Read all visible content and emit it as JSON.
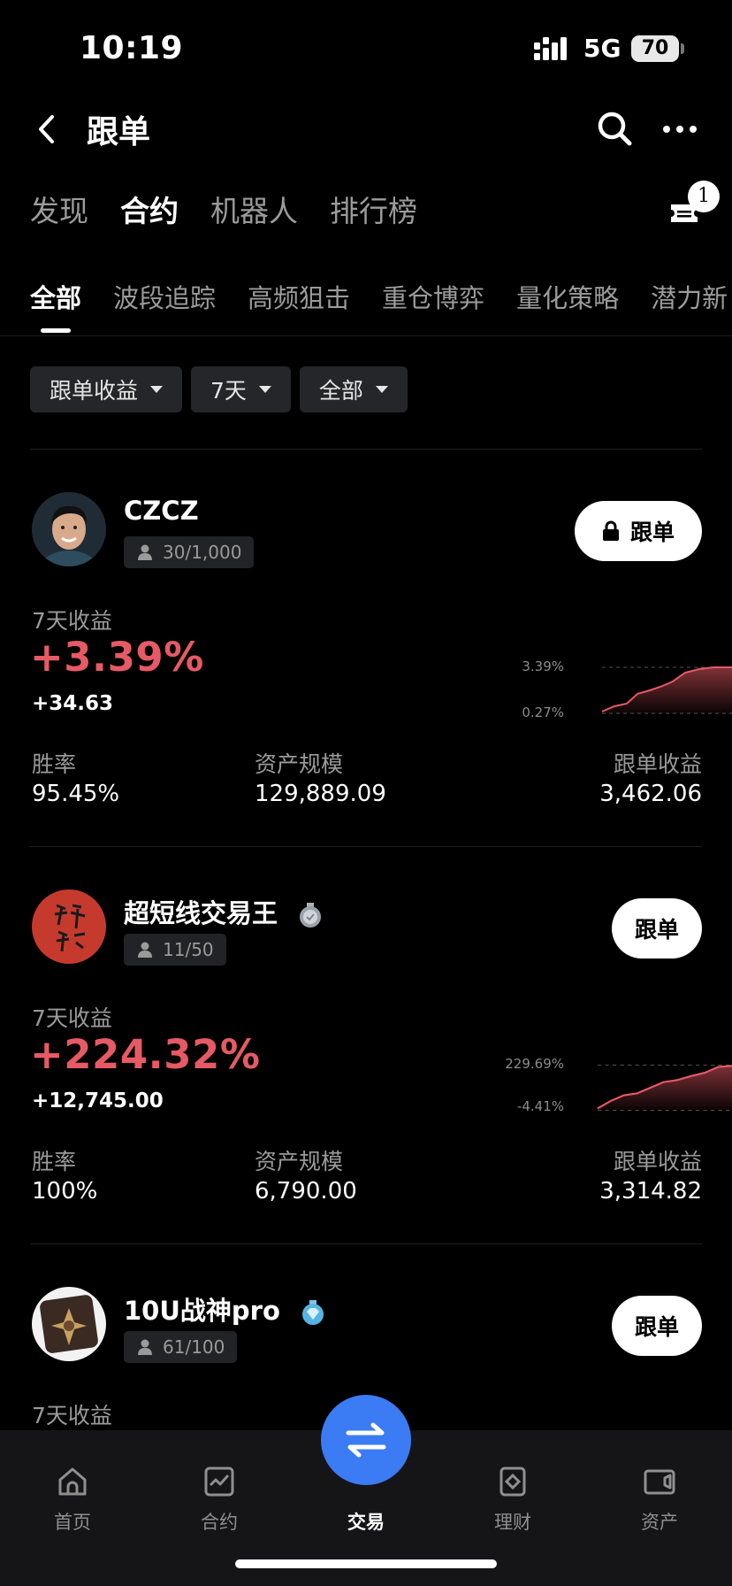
{
  "status_bar": {
    "time": "10:19",
    "network": "5G",
    "battery": "70"
  },
  "header": {
    "title": "跟单"
  },
  "main_tabs": [
    {
      "label": "发现",
      "active": false
    },
    {
      "label": "合约",
      "active": true
    },
    {
      "label": "机器人",
      "active": false
    },
    {
      "label": "排行榜",
      "active": false
    }
  ],
  "badge_count": "1",
  "sub_tabs": [
    {
      "label": "全部",
      "active": true
    },
    {
      "label": "波段追踪",
      "active": false
    },
    {
      "label": "高频狙击",
      "active": false
    },
    {
      "label": "重仓博弈",
      "active": false
    },
    {
      "label": "量化策略",
      "active": false
    },
    {
      "label": "潜力新",
      "active": false
    }
  ],
  "filters": [
    {
      "label": "跟单收益"
    },
    {
      "label": "7天"
    },
    {
      "label": "全部"
    }
  ],
  "traders": [
    {
      "name": "CZCZ",
      "followers": "30/1,000",
      "follow_label": "跟单",
      "locked": true,
      "profit_label": "7天收益",
      "profit_pct": "+3.39%",
      "profit_abs": "+34.63",
      "chart_hi": "3.39%",
      "chart_lo": "0.27%",
      "stats": {
        "win_label": "胜率",
        "win_value": "95.45%",
        "aum_label": "资产规模",
        "aum_value": "129,889.09",
        "copy_label": "跟单收益",
        "copy_value": "3,462.06"
      }
    },
    {
      "name": "超短线交易王",
      "followers": "11/50",
      "follow_label": "跟单",
      "locked": false,
      "profit_label": "7天收益",
      "profit_pct": "+224.32%",
      "profit_abs": "+12,745.00",
      "chart_hi": "229.69%",
      "chart_lo": "-4.41%",
      "stats": {
        "win_label": "胜率",
        "win_value": "100%",
        "aum_label": "资产规模",
        "aum_value": "6,790.00",
        "copy_label": "跟单收益",
        "copy_value": "3,314.82"
      }
    },
    {
      "name": "10U战神pro",
      "followers": "61/100",
      "follow_label": "跟单",
      "locked": false,
      "profit_label": "7天收益"
    }
  ],
  "bottom_nav": [
    {
      "label": "首页",
      "icon": "home-icon"
    },
    {
      "label": "合约",
      "icon": "contract-chart-icon"
    },
    {
      "label": "交易",
      "icon": "swap-arrows-icon",
      "active": true
    },
    {
      "label": "理财",
      "icon": "wealth-icon"
    },
    {
      "label": "资产",
      "icon": "wallet-icon"
    }
  ]
}
